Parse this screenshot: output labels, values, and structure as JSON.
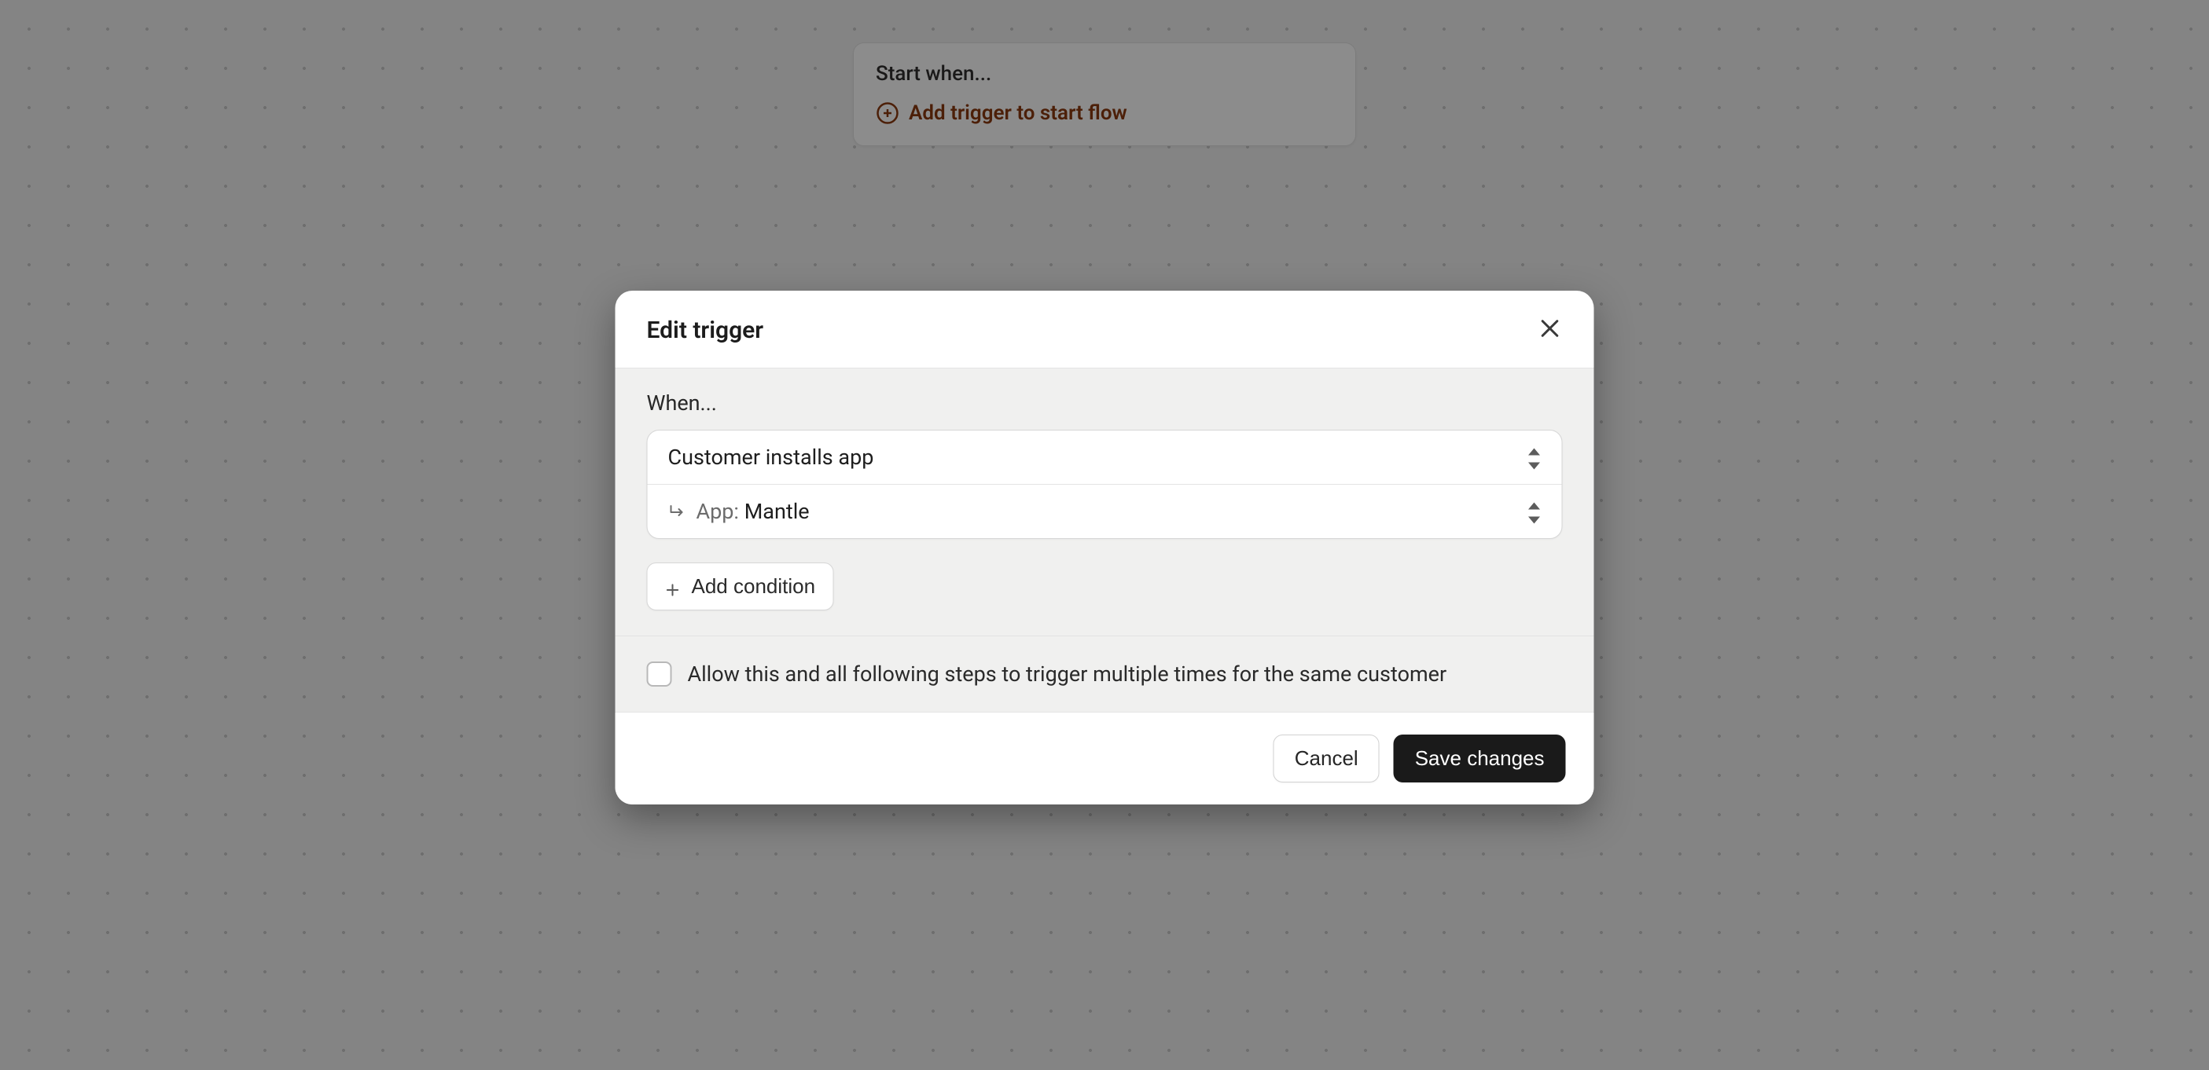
{
  "canvas": {
    "node": {
      "title": "Start when...",
      "add_trigger_label": "Add trigger to start flow"
    }
  },
  "modal": {
    "title": "Edit trigger",
    "when_label": "When...",
    "trigger_select": {
      "value": "Customer installs app"
    },
    "app_select": {
      "prefix": "App:",
      "value": "Mantle"
    },
    "add_condition_label": "Add condition",
    "allow_multiple": {
      "checked": false,
      "label": "Allow this and all following steps to trigger multiple times for the same customer"
    },
    "footer": {
      "cancel_label": "Cancel",
      "save_label": "Save changes"
    }
  }
}
